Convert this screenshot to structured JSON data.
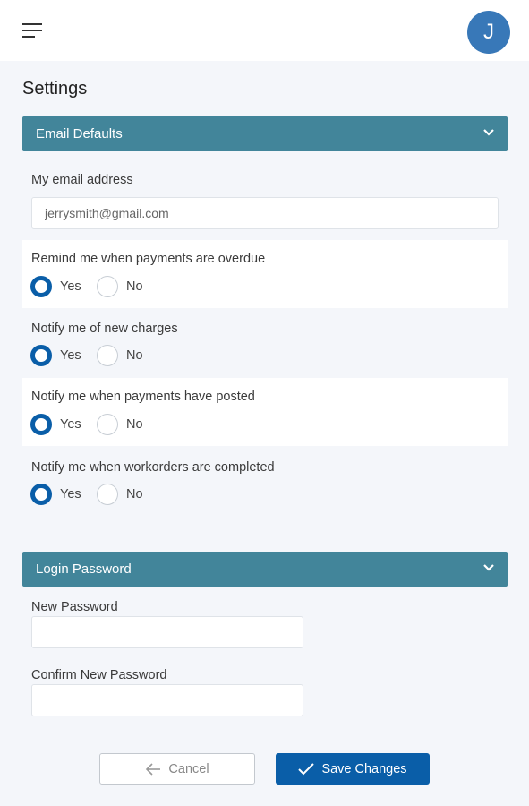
{
  "header": {
    "avatar_initial": "J"
  },
  "page": {
    "title": "Settings"
  },
  "email_defaults": {
    "title": "Email Defaults",
    "email_label": "My email address",
    "email_value": "jerrysmith@gmail.com",
    "questions": [
      {
        "label": "Remind me when payments are overdue",
        "yes": "Yes",
        "no": "No",
        "selected": "Yes"
      },
      {
        "label": "Notify me of new charges",
        "yes": "Yes",
        "no": "No",
        "selected": "Yes"
      },
      {
        "label": "Notify me when payments have posted",
        "yes": "Yes",
        "no": "No",
        "selected": "Yes"
      },
      {
        "label": "Notify me when workorders are completed",
        "yes": "Yes",
        "no": "No",
        "selected": "Yes"
      }
    ]
  },
  "login_password": {
    "title": "Login Password",
    "new_label": "New Password",
    "confirm_label": "Confirm New Password"
  },
  "actions": {
    "cancel": "Cancel",
    "save": "Save Changes"
  },
  "colors": {
    "section_header": "#42859a",
    "primary": "#0a5ea8",
    "avatar": "#3878b8"
  }
}
